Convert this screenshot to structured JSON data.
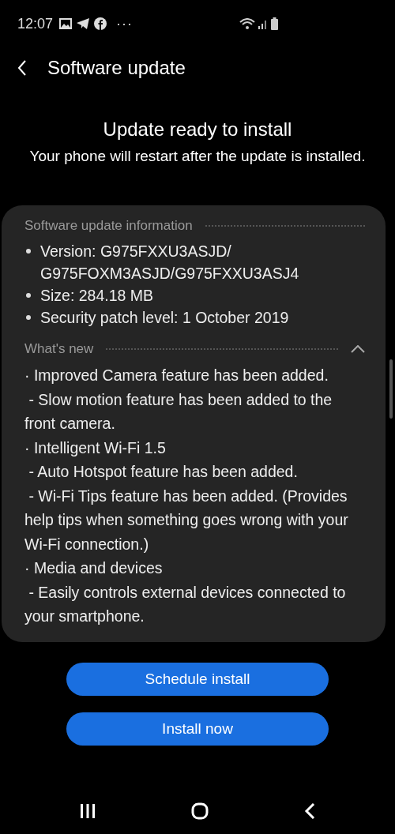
{
  "status_bar": {
    "time": "12:07",
    "more": "···"
  },
  "header": {
    "title": "Software update"
  },
  "intro": {
    "title": "Update ready to install",
    "message": "Your phone will restart after the update is installed."
  },
  "info": {
    "heading": "Software update information",
    "items": [
      "Version: G975FXXU3ASJD/ G975FOXM3ASJD/G975FXXU3ASJ4",
      "Size: 284.18 MB",
      "Security patch level: 1 October 2019"
    ]
  },
  "whats_new": {
    "heading": "What's new",
    "expanded": true,
    "lines": [
      "· Improved Camera feature has been added.",
      " - Slow motion feature has been added to the front camera.",
      "· Intelligent Wi-Fi 1.5",
      " - Auto Hotspot feature has been added.",
      " - Wi-Fi Tips feature has been added. (Provides help tips when something goes wrong with your Wi-Fi connection.)",
      "· Media and devices",
      " - Easily controls external devices connected to your smartphone."
    ]
  },
  "buttons": [
    "Schedule install",
    "Install now"
  ]
}
